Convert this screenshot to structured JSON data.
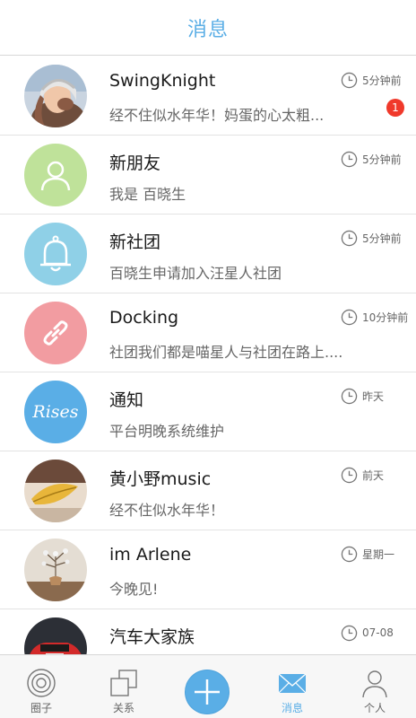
{
  "header": {
    "title": "消息"
  },
  "messages": [
    {
      "name": "SwingKnight",
      "preview": "经不住似水年华！妈蛋的心太粗...",
      "time": "5分钟前",
      "badge": "1",
      "avatar": "photo-portrait-woman"
    },
    {
      "name": "新朋友",
      "preview": "我是  百晓生",
      "time": "5分钟前",
      "avatar": "person-icon",
      "color": "#bfe29a"
    },
    {
      "name": "新社团",
      "preview": "百晓生申请加入汪星人社团",
      "time": "5分钟前",
      "avatar": "bell-icon",
      "color": "#8fd0e7"
    },
    {
      "name": "Docking",
      "preview": "社团我们都是喵星人与社团在路上......",
      "time": "10分钟前",
      "avatar": "link-icon",
      "color": "#f29ca1"
    },
    {
      "name": "通知",
      "preview": "平台明晚系统维护",
      "time": "昨天",
      "avatar": "rises-logo",
      "avatar_text": "Rises",
      "color": "#5aaee6"
    },
    {
      "name": "黄小野music",
      "preview": "经不住似水年华！",
      "time": "前天",
      "avatar": "photo-leaf"
    },
    {
      "name": "im Arlene",
      "preview": "今晚见!",
      "time": "星期一",
      "avatar": "photo-vase"
    },
    {
      "name": "汽车大家族",
      "preview": "",
      "time": "07-08",
      "avatar": "photo-car"
    }
  ],
  "tabbar": {
    "items": [
      {
        "label": "圈子",
        "icon": "circle-target-icon"
      },
      {
        "label": "关系",
        "icon": "relation-icon"
      },
      {
        "label": "",
        "icon": "plus-icon"
      },
      {
        "label": "消息",
        "icon": "mail-icon",
        "active": true
      },
      {
        "label": "个人",
        "icon": "person-icon"
      }
    ]
  },
  "colors": {
    "accent": "#5aaee6",
    "badge": "#f0392b"
  }
}
